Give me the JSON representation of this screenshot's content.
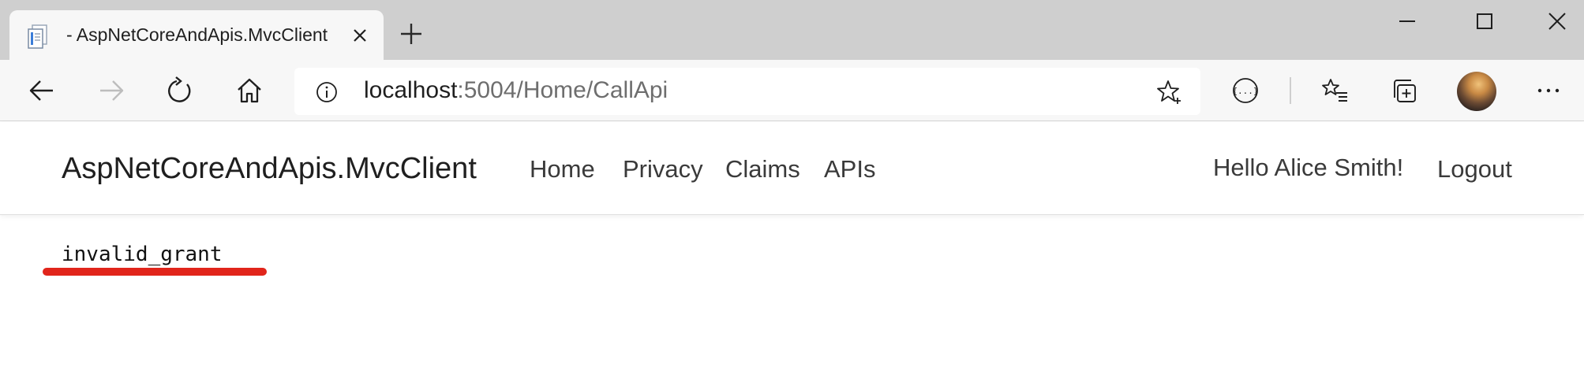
{
  "tab": {
    "title": "- AspNetCoreAndApis.MvcClient",
    "favicon": "page-icon"
  },
  "address_bar": {
    "host": "localhost",
    "rest": ":5004/Home/CallApi"
  },
  "navbar": {
    "brand": "AspNetCoreAndApis.MvcClient",
    "links": [
      "Home",
      "Privacy",
      "Claims",
      "APIs"
    ],
    "greeting": "Hello Alice Smith!",
    "logout": "Logout"
  },
  "content": {
    "error_text": "invalid_grant",
    "highlight_color": "#e1251b"
  },
  "icons": {
    "toolbar": [
      "back-icon",
      "forward-icon",
      "refresh-icon",
      "home-icon",
      "info-icon",
      "add-favorite-icon",
      "extension-icon",
      "favorites-icon",
      "collections-icon",
      "profile-avatar",
      "more-icon"
    ],
    "window": [
      "minimize-icon",
      "maximize-icon",
      "close-icon"
    ]
  }
}
